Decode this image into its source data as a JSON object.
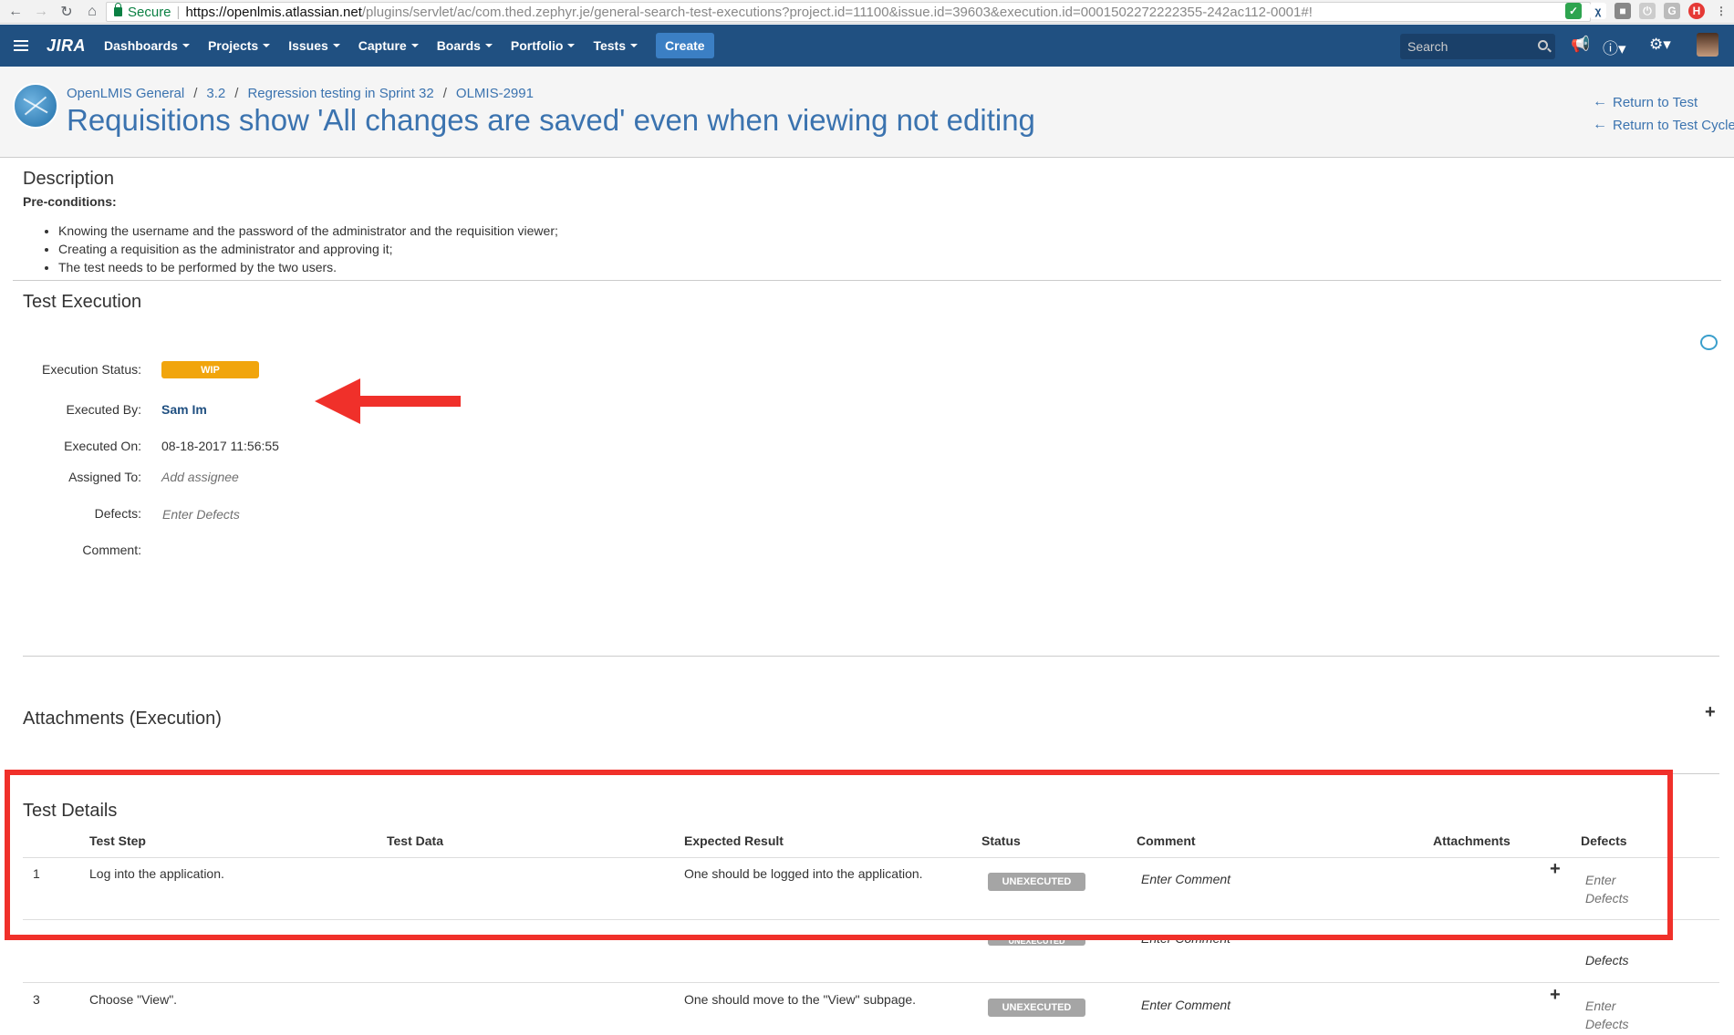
{
  "browser": {
    "secure_label": "Secure",
    "url_host": "https://openlmis.atlassian.net",
    "url_path": "/plugins/servlet/ac/com.thed.zephyr.je/general-search-test-executions?project.id=11100&issue.id=39603&execution.id=0001502272222355-242ac112-0001#!"
  },
  "header": {
    "logo": "JIRA",
    "menu": [
      "Dashboards",
      "Projects",
      "Issues",
      "Capture",
      "Boards",
      "Portfolio",
      "Tests"
    ],
    "create_label": "Create",
    "search_placeholder": "Search"
  },
  "issue": {
    "breadcrumb": [
      "OpenLMIS General",
      "3.2",
      "Regression testing in Sprint 32",
      "OLMIS-2991"
    ],
    "title": "Requisitions show 'All changes are saved' even when viewing not editing",
    "return_to_test": "Return to Test",
    "return_to_cycle": "Return to Test Cycle"
  },
  "description": {
    "heading": "Description",
    "preconditions_label": "Pre-conditions:",
    "bullets": [
      "Knowing the username and the password of the administrator and the requisition viewer;",
      "Creating a requisition as the administrator and approving it;",
      "The test needs to be performed by the two users."
    ]
  },
  "execution": {
    "heading": "Test Execution",
    "status_label": "Execution Status:",
    "status_value": "WIP",
    "status_color": "#f1a50c",
    "executed_by_label": "Executed By:",
    "executed_by": "Sam Im",
    "executed_on_label": "Executed On:",
    "executed_on": "08-18-2017 11:56:55",
    "assigned_to_label": "Assigned To:",
    "assigned_to": "Add assignee",
    "defects_label": "Defects:",
    "defects": "Enter Defects",
    "comment_label": "Comment:"
  },
  "attachments": {
    "heading": "Attachments (Execution)"
  },
  "test_details": {
    "heading": "Test Details",
    "columns": [
      "Test Step",
      "Test Data",
      "Expected Result",
      "Status",
      "Comment",
      "Attachments",
      "Defects"
    ],
    "rows": [
      {
        "num": "1",
        "step": "Log into the application.",
        "data": "",
        "expected": "One should be logged into the application.",
        "status": "UNEXECUTED",
        "comment": "Enter Comment",
        "defects_1": "Enter",
        "defects_2": "Defects"
      },
      {
        "num": "3",
        "step": "Choose \"View\".",
        "data": "",
        "expected": "One should move to the \"View\" subpage.",
        "status": "UNEXECUTED",
        "comment": "Enter Comment",
        "defects_1": "Enter",
        "defects_2": "Defects"
      }
    ],
    "row2_status": "UNEXECUTED",
    "row2_comment": "Enter Comment",
    "row2_defects": "Defects"
  },
  "annotations": {
    "arrow_color": "#f0302a",
    "box_color": "#f0302a"
  }
}
